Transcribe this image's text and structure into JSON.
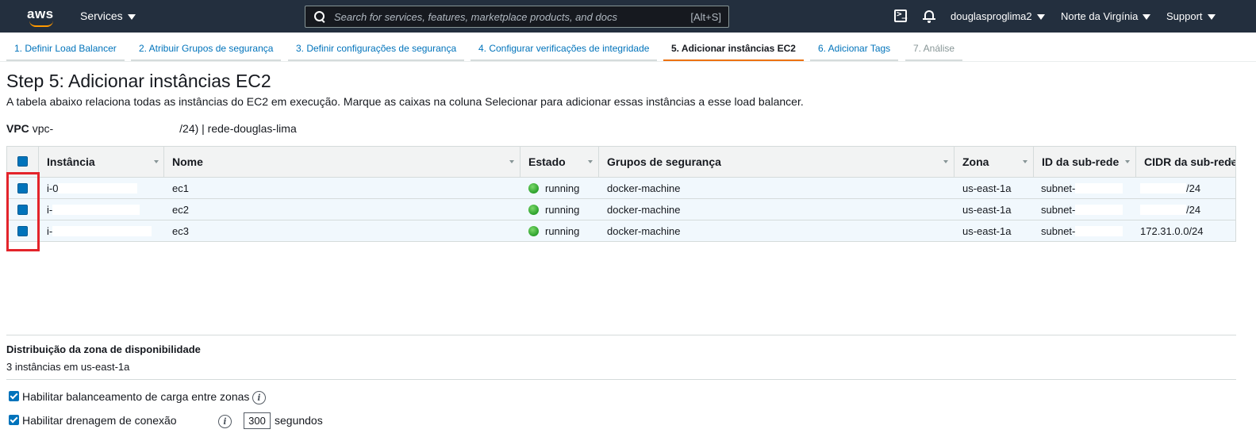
{
  "topnav": {
    "logo": "aws",
    "services": "Services",
    "search_placeholder": "Search for services, features, marketplace products, and docs",
    "search_shortcut": "[Alt+S]",
    "user": "douglasproglima2",
    "region": "Norte da Virgínia",
    "support": "Support"
  },
  "tabs": [
    {
      "label": "1. Definir Load Balancer"
    },
    {
      "label": "2. Atribuir Grupos de segurança"
    },
    {
      "label": "3. Definir configurações de segurança"
    },
    {
      "label": "4. Configurar verificações de integridade"
    },
    {
      "label": "5. Adicionar instâncias EC2"
    },
    {
      "label": "6. Adicionar Tags"
    },
    {
      "label": "7. Análise"
    }
  ],
  "step": {
    "title": "Step 5: Adicionar instâncias EC2",
    "description": "A tabela abaixo relaciona todas as instâncias do EC2 em execução. Marque as caixas na coluna Selecionar para adicionar essas instâncias a esse load balancer."
  },
  "vpc": {
    "label": "VPC",
    "id_prefix": "vpc-",
    "suffix": "/24) | rede-douglas-lima"
  },
  "table": {
    "columns": [
      "Instância",
      "Nome",
      "Estado",
      "Grupos de segurança",
      "Zona",
      "ID da sub-rede",
      "CIDR da sub-rede"
    ],
    "rows": [
      {
        "instance": "i-0",
        "name": "ec1",
        "state": "running",
        "groups": "docker-machine",
        "zone": "us-east-1a",
        "subnet": "subnet-",
        "cidr": "/24"
      },
      {
        "instance": "i-",
        "name": "ec2",
        "state": "running",
        "groups": "docker-machine",
        "zone": "us-east-1a",
        "subnet": "subnet-",
        "cidr": "/24"
      },
      {
        "instance": "i-",
        "name": "ec3",
        "state": "running",
        "groups": "docker-machine",
        "zone": "us-east-1a",
        "subnet": "subnet-",
        "cidr": "172.31.0.0/24"
      }
    ]
  },
  "az": {
    "title": "Distribuição da zona de disponibilidade",
    "value": "3 instâncias em us-east-1a"
  },
  "options": {
    "cross_zone": "Habilitar balanceamento de carga entre zonas",
    "draining": "Habilitar drenagem de conexão",
    "draining_value": "300",
    "draining_unit": "segundos"
  },
  "colors": {
    "nav_bg": "#232f3e",
    "accent": "#ec7211",
    "link": "#0073bb",
    "highlight": "#e3242b"
  }
}
